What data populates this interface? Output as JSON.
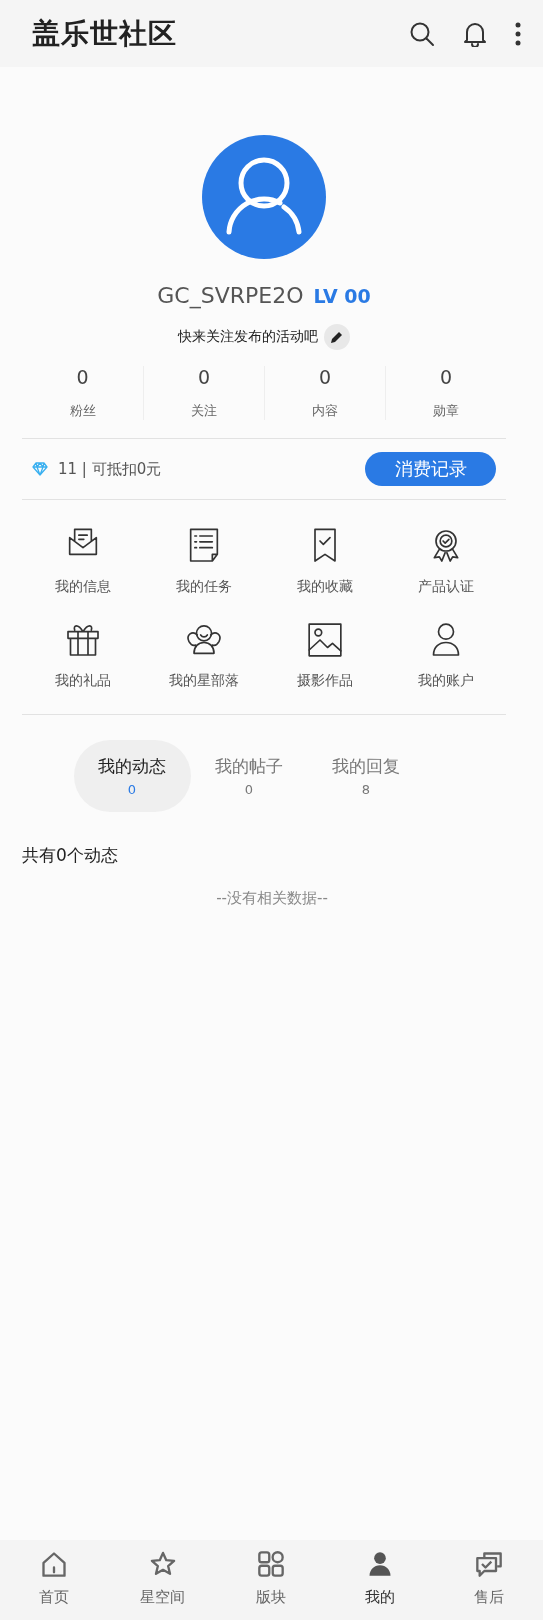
{
  "app_bar": {
    "title": "盖乐世社区"
  },
  "profile": {
    "username": "GC_SVRPE2O",
    "level": "LV 00",
    "bio": "快来关注发布的活动吧"
  },
  "stats": [
    {
      "value": "0",
      "label": "粉丝"
    },
    {
      "value": "0",
      "label": "关注"
    },
    {
      "value": "0",
      "label": "内容"
    },
    {
      "value": "0",
      "label": "勋章"
    }
  ],
  "points": {
    "text": "11 | 可抵扣0元",
    "button": "消费记录"
  },
  "menu": [
    {
      "label": "我的信息"
    },
    {
      "label": "我的任务"
    },
    {
      "label": "我的收藏"
    },
    {
      "label": "产品认证"
    },
    {
      "label": "我的礼品"
    },
    {
      "label": "我的星部落"
    },
    {
      "label": "摄影作品"
    },
    {
      "label": "我的账户"
    }
  ],
  "tabs": [
    {
      "label": "我的动态",
      "count": "0",
      "selected": true
    },
    {
      "label": "我的帖子",
      "count": "0",
      "selected": false
    },
    {
      "label": "我的回复",
      "count": "8",
      "selected": false
    }
  ],
  "feed": {
    "summary": "共有0个动态",
    "empty_text": "--没有相关数据--"
  },
  "bottom_nav": [
    {
      "label": "首页",
      "selected": false
    },
    {
      "label": "星空间",
      "selected": false
    },
    {
      "label": "版块",
      "selected": false
    },
    {
      "label": "我的",
      "selected": true
    },
    {
      "label": "售后",
      "selected": false
    }
  ]
}
